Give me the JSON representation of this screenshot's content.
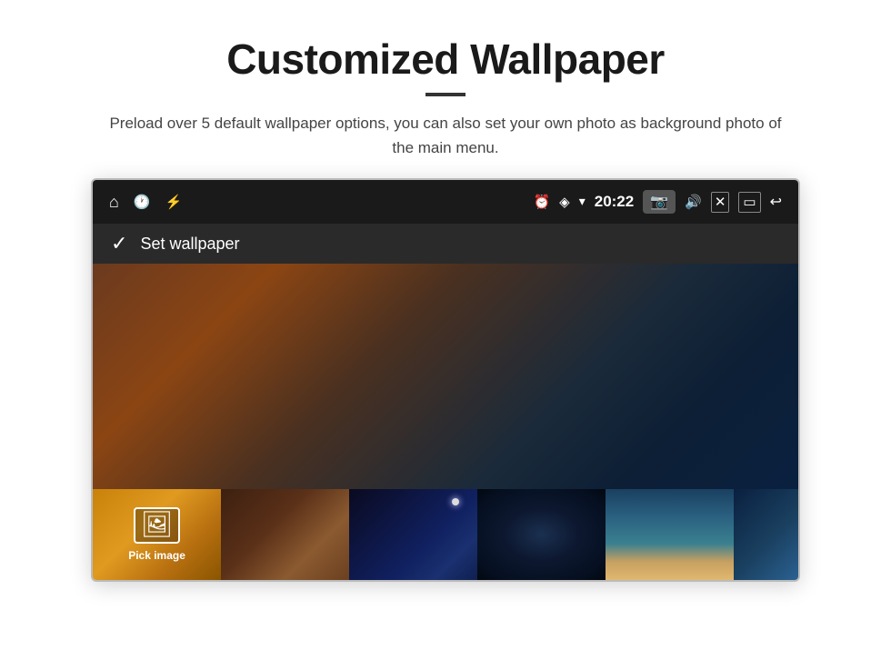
{
  "page": {
    "title": "Customized Wallpaper",
    "subtitle": "Preload over 5 default wallpaper options, you can also set your own photo as background photo of the main menu.",
    "divider_color": "#333333"
  },
  "device": {
    "status_bar": {
      "time": "20:22",
      "left_icons": [
        "home",
        "clock",
        "usb"
      ],
      "right_icons": [
        "alarm",
        "location",
        "wifi",
        "camera",
        "volume",
        "close",
        "window",
        "back"
      ]
    },
    "action_bar": {
      "check_label": "✓",
      "action_label": "Set wallpaper"
    },
    "thumbnails": [
      {
        "id": "pick",
        "label": "Pick image",
        "type": "pick"
      },
      {
        "id": "thumb1",
        "type": "brown-dark"
      },
      {
        "id": "thumb2",
        "type": "space-blue"
      },
      {
        "id": "thumb3",
        "type": "galaxy"
      },
      {
        "id": "thumb4",
        "type": "ocean-sunset"
      },
      {
        "id": "thumb5",
        "type": "deep-blue"
      },
      {
        "id": "thumb6",
        "type": "dark-space"
      }
    ]
  }
}
